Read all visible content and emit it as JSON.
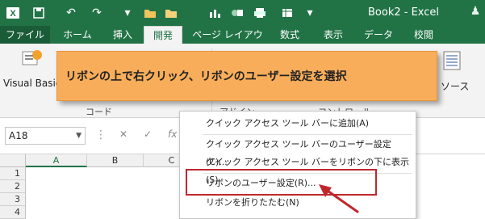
{
  "window": {
    "title": "Book2 - Excel"
  },
  "quick_access": {
    "icons": [
      "excel-logo-icon",
      "save-icon",
      "undo-icon",
      "redo-icon",
      "open-folder-icon",
      "folder-icon",
      "chart-icon",
      "shapes-icon",
      "print-icon",
      "pivot-icon"
    ]
  },
  "tabs": [
    {
      "label": "ファイル",
      "active": false
    },
    {
      "label": "ホーム",
      "active": false
    },
    {
      "label": "挿入",
      "active": false
    },
    {
      "label": "開発",
      "active": true
    },
    {
      "label": "ページ レイアウト",
      "active": false
    },
    {
      "label": "数式",
      "active": false
    },
    {
      "label": "表示",
      "active": false
    },
    {
      "label": "データ",
      "active": false
    },
    {
      "label": "校閲",
      "active": false
    }
  ],
  "ribbon": {
    "visual_basic_label": "Visual Basic",
    "source_label": "ソース",
    "groups": [
      "コード",
      "アドイン",
      "コントロール"
    ]
  },
  "callout": {
    "text": "リボンの上で右クリック、リボンのユーザー設定を選択"
  },
  "formula_bar": {
    "name_box": "A18",
    "cancel_symbol": "✕",
    "enter_symbol": "✓",
    "fx_symbol": "fx"
  },
  "grid": {
    "columns": [
      "A",
      "B",
      "C"
    ],
    "rows": [
      "1",
      "2",
      "3",
      "4"
    ]
  },
  "context_menu": {
    "items": [
      "クイック アクセス ツール バーに追加(A)",
      "クイック アクセス ツール バーのユーザー設定(C)...",
      "クイック アクセス ツール バーをリボンの下に表示(S)",
      "リボンのユーザー設定(R)...",
      "リボンを折りたたむ(N)"
    ]
  },
  "colors": {
    "excel_green": "#217346",
    "callout_orange": "#f8ad5a",
    "highlight_red": "#c0272d"
  }
}
